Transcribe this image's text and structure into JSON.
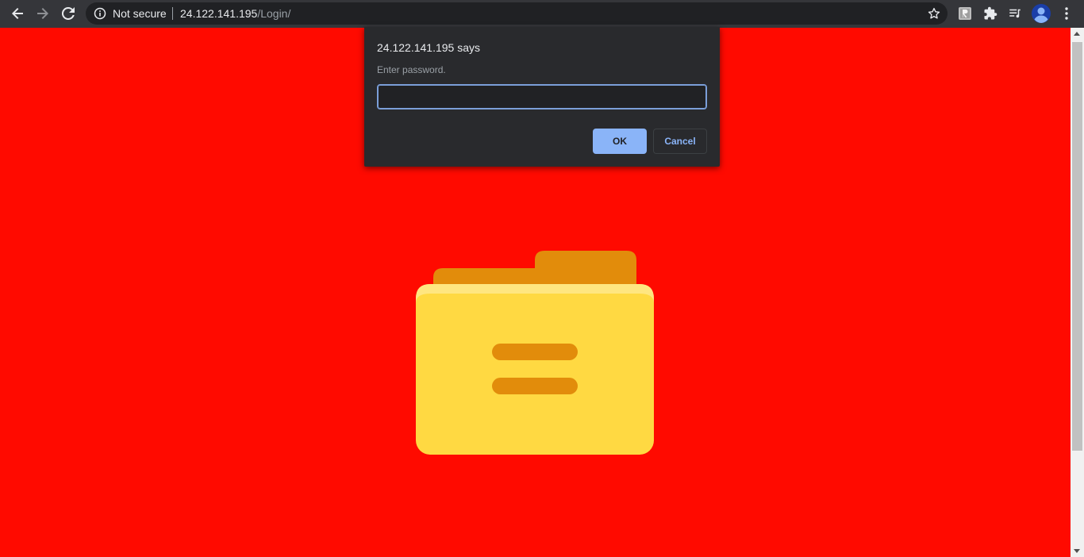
{
  "browser": {
    "security_label": "Not secure",
    "url_host": "24.122.141.195",
    "url_path": "/Login/",
    "icons": [
      "back-icon",
      "forward-icon",
      "reload-icon",
      "info-icon",
      "star-icon",
      "extension-r-icon",
      "puzzle-icon",
      "media-queue-icon",
      "profile-avatar-icon",
      "more-menu-icon"
    ]
  },
  "dialog": {
    "title": "24.122.141.195 says",
    "message": "Enter password.",
    "input_value": "",
    "ok_label": "OK",
    "cancel_label": "Cancel"
  },
  "page": {
    "background_color": "#ff0a00",
    "illustration": "folder-icon",
    "colors": {
      "folder_front": "#ffd942",
      "folder_back": "#e28c0b"
    }
  }
}
